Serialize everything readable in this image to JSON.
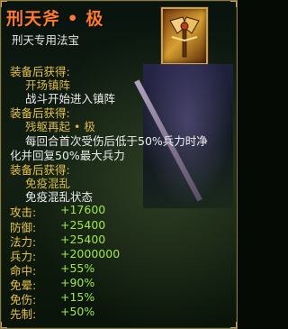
{
  "item": {
    "title": "刑天斧 • 极",
    "subtitle": "刑天专用法宝"
  },
  "sections": [
    {
      "header": "装备后获得:",
      "name": "开场镇阵",
      "desc": [
        "战斗开始进入镇阵"
      ]
    },
    {
      "header": "装备后获得:",
      "name": "残躯再起 • 极",
      "desc": [
        "每回合首次受伤后低于50%兵力时净",
        "化并回复50%最大兵力"
      ]
    },
    {
      "header": "装备后获得:",
      "name": "免疫混乱",
      "desc": [
        "免疫混乱状态"
      ]
    }
  ],
  "stats": [
    {
      "label": "攻击:",
      "value": "+17600"
    },
    {
      "label": "防御:",
      "value": "+25400"
    },
    {
      "label": "法力:",
      "value": "+25400"
    },
    {
      "label": "兵力:",
      "value": "+2000000"
    },
    {
      "label": "命中:",
      "value": "+55%"
    },
    {
      "label": "免晕:",
      "value": "+90%"
    },
    {
      "label": "免伤:",
      "value": "+15%"
    },
    {
      "label": "先制:",
      "value": "+50%"
    }
  ],
  "colors": {
    "title": "#ff7a2a",
    "header": "#e8c24a",
    "value": "#9ee94a",
    "border": "#8b7a48"
  },
  "icons": {
    "item_icon": "axe-icon"
  }
}
